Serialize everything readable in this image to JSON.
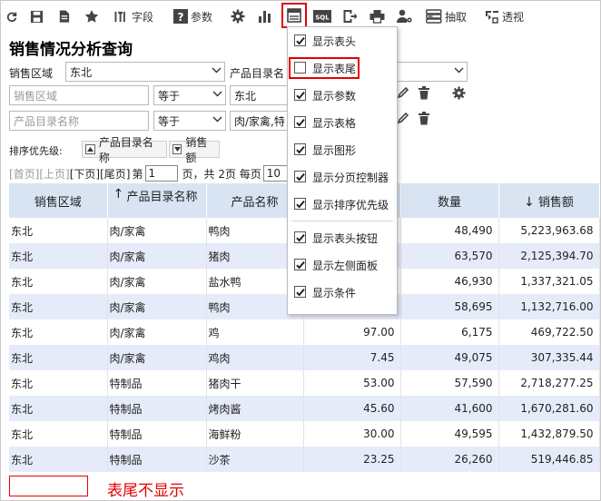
{
  "toolbar": {
    "fields_label": "字段",
    "params_label": "参数",
    "sql_label": "SQL",
    "extract_label": "抽取",
    "pivot_label": "透视"
  },
  "title": "销售情况分析查询",
  "params": {
    "row1": {
      "label1": "销售区域",
      "value1": "东北",
      "label2": "产品目录名"
    },
    "row2": {
      "placeholder": "销售区域",
      "op": "等于",
      "value": "东北"
    },
    "row3": {
      "placeholder": "产品目录名称",
      "op": "等于",
      "value": "肉/家禽,特"
    }
  },
  "sort": {
    "label": "排序优先级:",
    "items": [
      {
        "label": "产品目录名称",
        "dir": "asc"
      },
      {
        "label": "销售额",
        "dir": "desc"
      }
    ]
  },
  "pager": {
    "first": "[首页]",
    "prev": "[上页]",
    "next": "[下页]",
    "last": "[尾页]",
    "page_prefix": "第",
    "page": "1",
    "page_suffix": "页，共 2页 每页",
    "per_page": "10"
  },
  "table": {
    "headers": [
      "销售区域",
      "产品目录名称",
      "产品名称",
      "",
      "数量",
      "销售额"
    ],
    "rows": [
      [
        "东北",
        "肉/家禽",
        "鸭肉",
        "",
        "48,490",
        "5,223,963.68"
      ],
      [
        "东北",
        "肉/家禽",
        "猪肉",
        "",
        "63,570",
        "2,125,394.70"
      ],
      [
        "东北",
        "肉/家禽",
        "盐水鸭",
        "",
        "46,930",
        "1,337,321.05"
      ],
      [
        "东北",
        "肉/家禽",
        "鸭肉",
        "",
        "58,695",
        "1,132,716.00"
      ],
      [
        "东北",
        "肉/家禽",
        "鸡",
        "97.00",
        "6,175",
        "469,722.50"
      ],
      [
        "东北",
        "肉/家禽",
        "鸡肉",
        "7.45",
        "49,075",
        "307,335.44"
      ],
      [
        "东北",
        "特制品",
        "猪肉干",
        "53.00",
        "57,590",
        "2,718,277.25"
      ],
      [
        "东北",
        "特制品",
        "烤肉酱",
        "45.60",
        "41,600",
        "1,670,281.60"
      ],
      [
        "东北",
        "特制品",
        "海鲜粉",
        "30.00",
        "49,595",
        "1,432,879.50"
      ],
      [
        "东北",
        "特制品",
        "沙茶",
        "23.25",
        "26,260",
        "519,446.85"
      ]
    ]
  },
  "menu": {
    "items": [
      {
        "label": "显示表头",
        "checked": true
      },
      {
        "label": "显示表尾",
        "checked": false
      },
      {
        "label": "显示参数",
        "checked": true
      },
      {
        "label": "显示表格",
        "checked": true
      },
      {
        "label": "显示图形",
        "checked": true
      },
      {
        "label": "显示分页控制器",
        "checked": true
      },
      {
        "label": "显示排序优先级",
        "checked": true
      },
      {
        "label": "显示表头按钮",
        "checked": true
      },
      {
        "label": "显示左侧面板",
        "checked": true
      },
      {
        "label": "显示条件",
        "checked": true
      }
    ]
  },
  "note": "表尾不显示",
  "colors": {
    "accent_red": "#e60000",
    "header_bg": "#d8e4f2",
    "alt_row": "#e6ebfa"
  }
}
